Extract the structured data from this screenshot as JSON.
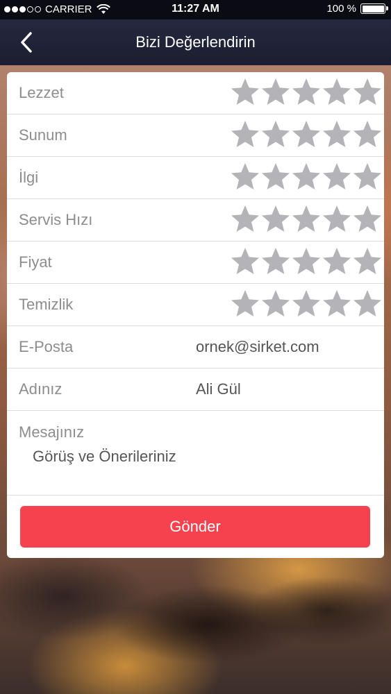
{
  "status_bar": {
    "carrier": "CARRIER",
    "time": "11:27 AM",
    "battery_percent": "100 %",
    "signal_bars_filled": 3,
    "signal_bars_total": 5
  },
  "navbar": {
    "title": "Bizi Değerlendirin",
    "back_icon": "chevron-left-icon"
  },
  "ratings": [
    {
      "label": "Lezzet",
      "stars": 0,
      "max_stars": 5
    },
    {
      "label": "Sunum",
      "stars": 0,
      "max_stars": 5
    },
    {
      "label": "İlgi",
      "stars": 0,
      "max_stars": 5
    },
    {
      "label": "Servis Hızı",
      "stars": 0,
      "max_stars": 5
    },
    {
      "label": "Fiyat",
      "stars": 0,
      "max_stars": 5
    },
    {
      "label": "Temizlik",
      "stars": 0,
      "max_stars": 5
    }
  ],
  "fields": {
    "email": {
      "label": "E-Posta",
      "placeholder": "ornek@sirket.com"
    },
    "name": {
      "label": "Adınız",
      "placeholder": "Ali Gül"
    },
    "message": {
      "label": "Mesajınız",
      "placeholder": "Görüş ve Önerileriniz"
    }
  },
  "submit_label": "Gönder",
  "colors": {
    "accent": "#f6424f",
    "navbar": "#1f2135",
    "star_empty": "#b3b3b8",
    "label": "#8d8d8d"
  }
}
